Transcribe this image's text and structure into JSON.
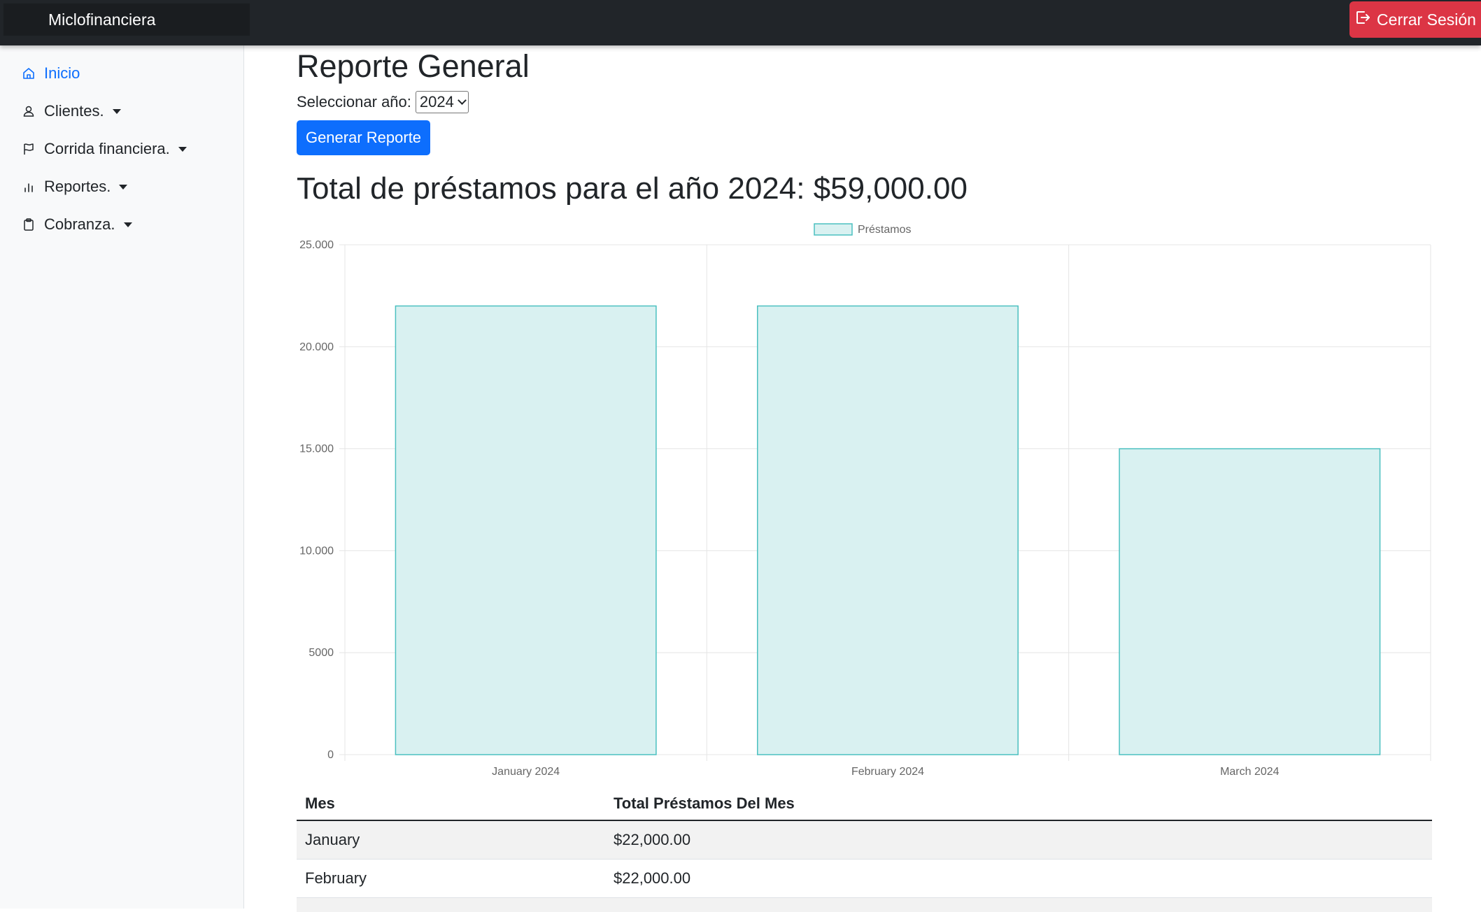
{
  "header": {
    "brand": "Miclofinanciera",
    "logout_label": "Cerrar Sesión"
  },
  "sidebar": {
    "items": [
      {
        "label": "Inicio",
        "icon": "home-icon",
        "active": true
      },
      {
        "label": "Clientes.",
        "icon": "user-icon",
        "dropdown": true
      },
      {
        "label": "Corrida financiera.",
        "icon": "flag-icon",
        "dropdown": true
      },
      {
        "label": "Reportes.",
        "icon": "bar-chart-icon",
        "dropdown": true
      },
      {
        "label": "Cobranza.",
        "icon": "clipboard-icon",
        "dropdown": true
      }
    ]
  },
  "main": {
    "title": "Reporte General",
    "year_label": "Seleccionar año:",
    "year_value": "2024",
    "generate_label": "Generar Reporte",
    "total_text": "Total de préstamos para el año 2024: $59,000.00"
  },
  "chart_data": {
    "type": "bar",
    "categories": [
      "January 2024",
      "February 2024",
      "March 2024"
    ],
    "series": [
      {
        "name": "Préstamos",
        "values": [
          22000,
          22000,
          15000
        ]
      }
    ],
    "ylim": [
      0,
      25000
    ],
    "yticks": [
      "0",
      "5000",
      "10.000",
      "15.000",
      "20.000",
      "25.000"
    ],
    "grid": true,
    "legend": "top-center",
    "colors": {
      "fill": "#d9f1f1",
      "stroke": "#4bc0c0",
      "grid": "#e5e5e5",
      "tick_text": "#666666"
    }
  },
  "table": {
    "headers": [
      "Mes",
      "Total Préstamos Del Mes"
    ],
    "rows": [
      [
        "January",
        "$22,000.00"
      ],
      [
        "February",
        "$22,000.00"
      ]
    ]
  },
  "colors": {
    "topbar": "#212529",
    "danger": "#dc3545",
    "primary": "#0d6efd",
    "sidebar_bg": "#f8f9fa"
  }
}
